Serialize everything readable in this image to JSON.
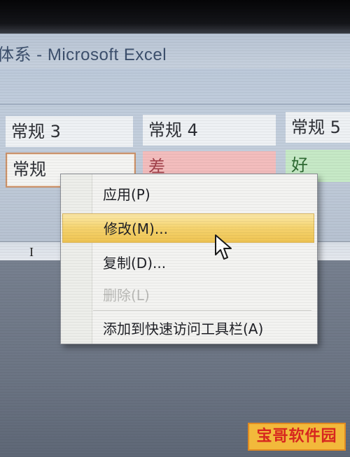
{
  "window": {
    "title": "体系 - Microsoft Excel"
  },
  "cell_styles": {
    "normal3": "常规 3",
    "normal4": "常规 4",
    "normal5": "常规 5",
    "normal": "常规",
    "bad": "差",
    "good": "好"
  },
  "formula_bar": {
    "cursor_glyph": "I"
  },
  "context_menu": {
    "items": [
      {
        "label": "应用(P)",
        "enabled": true,
        "highlighted": false
      },
      {
        "label": "修改(M)...",
        "enabled": true,
        "highlighted": true
      },
      {
        "label": "复制(D)...",
        "enabled": true,
        "highlighted": false
      },
      {
        "label": "删除(L)",
        "enabled": false,
        "highlighted": false
      },
      {
        "label": "添加到快速访问工具栏(A)",
        "enabled": true,
        "highlighted": false
      }
    ]
  },
  "watermark": {
    "text": "宝哥软件园"
  },
  "colors": {
    "highlight": "#f5d36e",
    "bad_fill": "#f3bdbd",
    "good_fill": "#c6e9c6",
    "title_text": "#3c4f6c"
  },
  "icons": {
    "cursor": "mouse-pointer-icon"
  }
}
